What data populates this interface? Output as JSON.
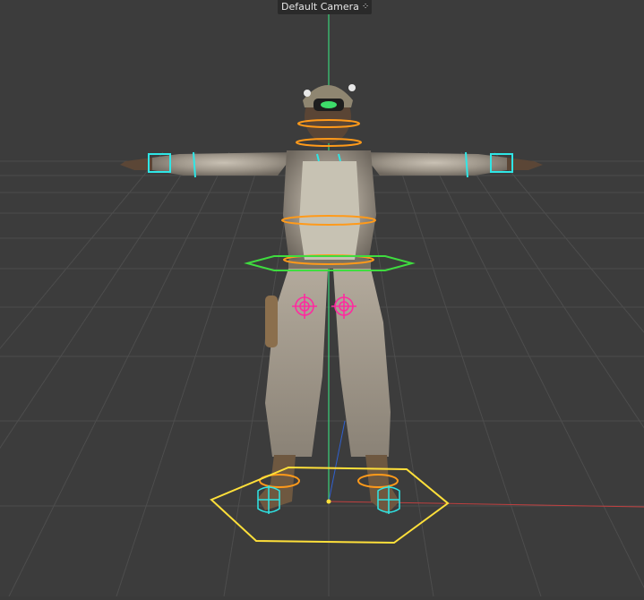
{
  "viewport": {
    "camera_label": "Default Camera",
    "camera_icon": "camera-menu-icon",
    "background_color": "#3c3c3c",
    "grid_color": "#4c4c4c",
    "axis_colors": {
      "y": "#3bd37a",
      "x": "#d04040",
      "z": "#3060d0"
    }
  },
  "rig": {
    "controller_colors": {
      "limb": "#2fe6e6",
      "spine": "#ff9a1a",
      "root": "#3fdc3f",
      "hip": "#ff2aa0",
      "foot_base": "#ffe03a"
    }
  }
}
